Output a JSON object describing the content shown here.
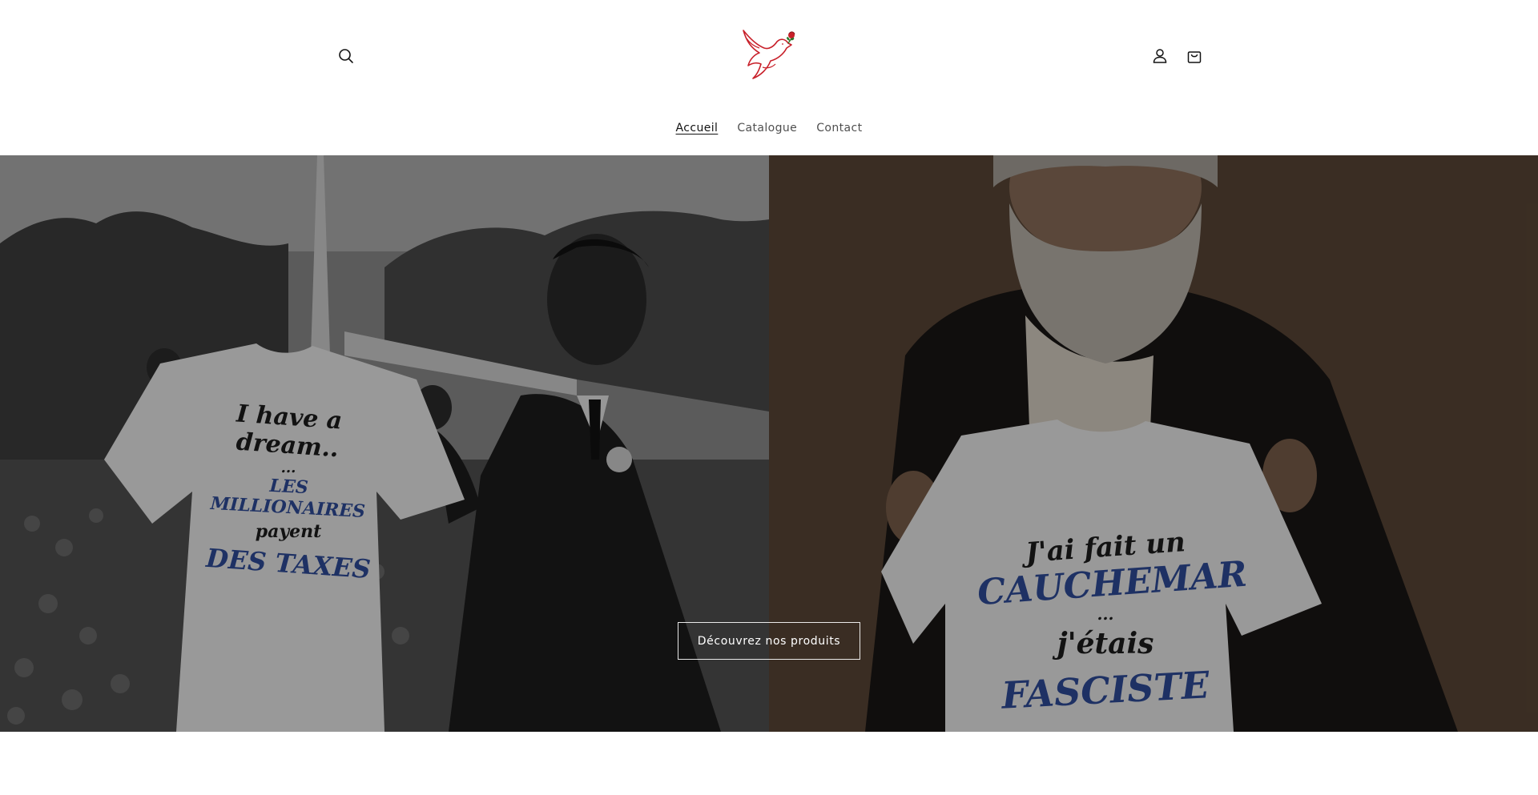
{
  "header": {
    "search_label": "Recherche",
    "account_label": "Connexion",
    "cart_label": "Panier",
    "logo_icon": "dove-with-rose-icon"
  },
  "nav": {
    "items": [
      {
        "label": "Accueil",
        "active": true
      },
      {
        "label": "Catalogue",
        "active": false
      },
      {
        "label": "Contact",
        "active": false
      }
    ]
  },
  "hero": {
    "left_shirt": {
      "line1": "I have a dream..",
      "line2": "...",
      "line3": "LES MILLIONAIRES",
      "line4": "payent",
      "line5": "DES TAXES"
    },
    "right_shirt": {
      "line1": "J'ai fait un",
      "line2": "CAUCHEMAR",
      "line3": "...",
      "line4": "j'étais",
      "line5": "FASCISTE"
    },
    "cta_label": "Découvrez nos produits"
  },
  "colors": {
    "accent_red": "#c8202a",
    "shirt_text_dark": "#1d1d1d",
    "shirt_text_blue": "#2f4c9a"
  }
}
